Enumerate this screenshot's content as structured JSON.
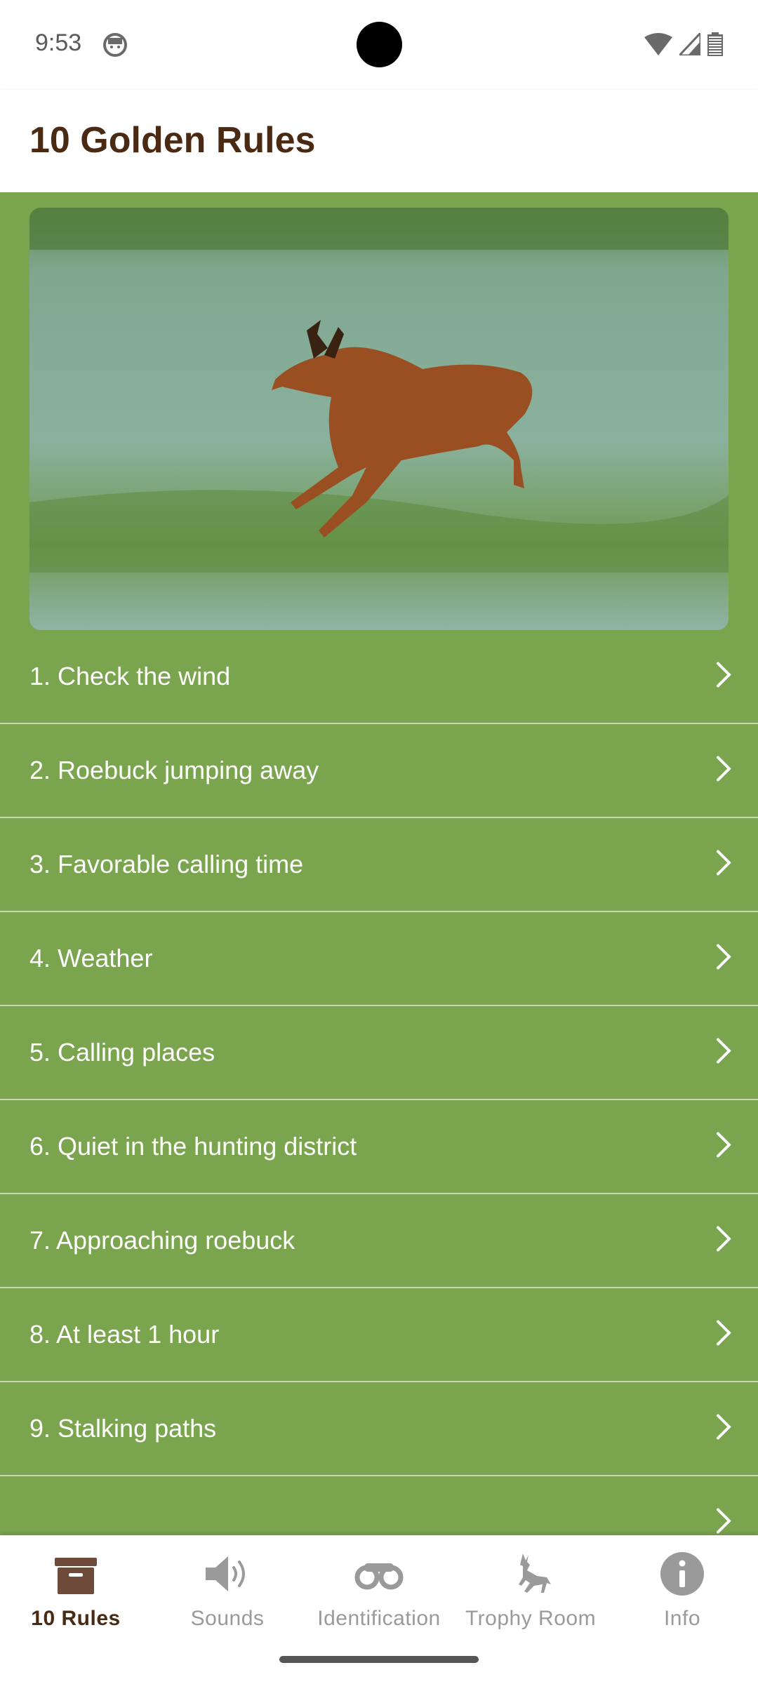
{
  "status_bar": {
    "time": "9:53"
  },
  "header": {
    "title": "10 Golden Rules"
  },
  "rules": [
    {
      "label": "1. Check the wind"
    },
    {
      "label": "2. Roebuck jumping away"
    },
    {
      "label": "3. Favorable calling time"
    },
    {
      "label": "4. Weather"
    },
    {
      "label": "5. Calling places"
    },
    {
      "label": "6. Quiet in the hunting district"
    },
    {
      "label": "7. Approaching roebuck"
    },
    {
      "label": "8. At least 1 hour"
    },
    {
      "label": "9. Stalking paths"
    },
    {
      "label": ""
    }
  ],
  "bottom_nav": {
    "items": [
      {
        "label": "10 Rules",
        "icon": "archive-box-icon",
        "active": true
      },
      {
        "label": "Sounds",
        "icon": "speaker-icon",
        "active": false
      },
      {
        "label": "Identification",
        "icon": "binoculars-icon",
        "active": false
      },
      {
        "label": "Trophy Room",
        "icon": "deer-icon",
        "active": false
      },
      {
        "label": "Info",
        "icon": "info-icon",
        "active": false
      }
    ]
  },
  "colors": {
    "background": "#7aa44d",
    "title": "#4a2a12",
    "nav_inactive": "#9a9a9a"
  }
}
